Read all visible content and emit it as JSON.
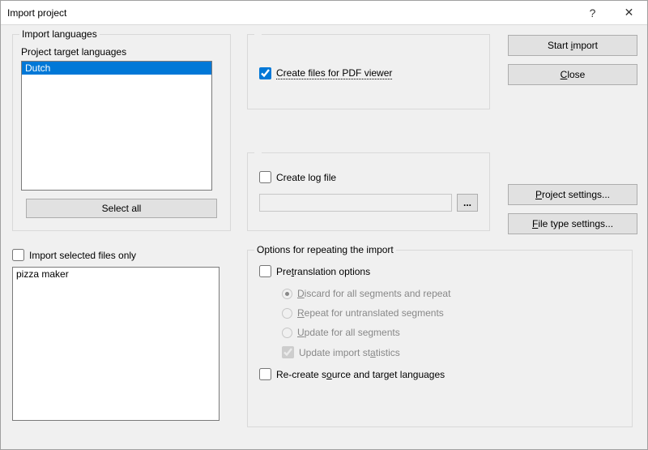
{
  "title": "Import project",
  "helpGlyph": "?",
  "closeGlyph": "✕",
  "groups": {
    "importLanguages": "Import languages",
    "repeatOptions": "Options for repeating the import"
  },
  "labels": {
    "targetLanguages": "Project target languages"
  },
  "targetLanguages": [
    "Dutch"
  ],
  "buttons": {
    "selectAll": "Select all",
    "startImport": "Start import",
    "close": "Close",
    "projectSettings": "Project settings...",
    "fileTypeSettings": "File type settings...",
    "browse": "..."
  },
  "checkboxes": {
    "createPdf": "Create files for PDF viewer",
    "createLog": "Create log file",
    "importSelectedOnly": "Import selected files only",
    "pretranslation": "Pretranslation options",
    "updateStats": "Update import statistics",
    "recreateLangs": "Re-create source and target languages"
  },
  "radios": {
    "discard": "Discard for all segments and repeat",
    "repeatUntranslated": "Repeat for untranslated segments",
    "updateAll": "Update for all segments"
  },
  "files": [
    "pizza maker"
  ],
  "logPath": ""
}
